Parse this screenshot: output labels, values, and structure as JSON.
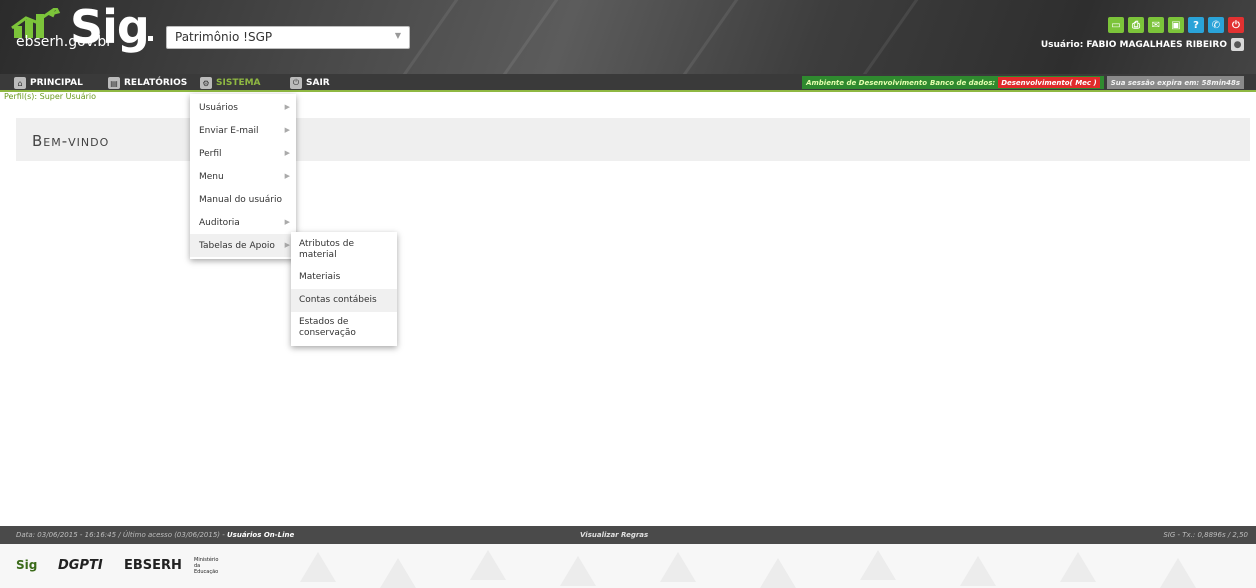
{
  "header": {
    "domain": "ebserh.gov.br",
    "logo_text": "Sig",
    "system_select": {
      "value": "Patrimônio !SGP"
    },
    "user_label": "Usuário: FABIO MAGALHAES RIBEIRO",
    "top_icons": [
      {
        "name": "monitor-icon",
        "color": "#7cc43a",
        "glyph": "▭"
      },
      {
        "name": "print-icon",
        "color": "#7cc43a",
        "glyph": "⎙"
      },
      {
        "name": "mail-icon",
        "color": "#7cc43a",
        "glyph": "✉"
      },
      {
        "name": "chat-icon",
        "color": "#7cc43a",
        "glyph": "▣"
      },
      {
        "name": "help-icon",
        "color": "#2aa3d8",
        "glyph": "?"
      },
      {
        "name": "phone-icon",
        "color": "#2aa3d8",
        "glyph": "✆"
      },
      {
        "name": "power-icon",
        "color": "#e23131",
        "glyph": "⏻"
      }
    ]
  },
  "nav": {
    "items": [
      {
        "label": "PRINCIPAL",
        "icon": "home-icon",
        "glyph": "⌂"
      },
      {
        "label": "RELATÓRIOS",
        "icon": "chart-icon",
        "glyph": "▤"
      },
      {
        "label": "SISTEMA",
        "icon": "gear-icon",
        "glyph": "⚙"
      },
      {
        "label": "SAIR",
        "icon": "power-icon",
        "glyph": "⏻"
      }
    ],
    "env_label": "Ambiente de Desenvolvimento",
    "db_label": "Banco de dados:",
    "db_value": "Desenvolvimento( Mec )",
    "session_label": "Sua sessão expira em: 58min48s"
  },
  "profile_text": "Perfil(s): Super Usuário",
  "welcome_title": "Bem-vindo",
  "system_menu": {
    "items": [
      {
        "label": "Usuários",
        "has_sub": true
      },
      {
        "label": "Enviar E-mail",
        "has_sub": true
      },
      {
        "label": "Perfil",
        "has_sub": true
      },
      {
        "label": "Menu",
        "has_sub": true
      },
      {
        "label": "Manual do usuário",
        "has_sub": false
      },
      {
        "label": "Auditoria",
        "has_sub": true
      },
      {
        "label": "Tabelas de Apoio",
        "has_sub": true
      }
    ],
    "submenu": [
      {
        "label": "Atributos de material"
      },
      {
        "label": "Materiais"
      },
      {
        "label": "Contas contábeis"
      },
      {
        "label": "Estados de conservação"
      }
    ]
  },
  "footer": {
    "left_text": "Data: 03/06/2015 - 16:16:45 / Último acesso (03/06/2015) -",
    "online_link": "Usuários On-Line",
    "center_link": "Visualizar Regras",
    "right_text": "SIG - Tx.: 0,8896s / 2,50",
    "logos": [
      "Sig",
      "DGPTI",
      "EBSERH",
      "Ministério da Educação"
    ]
  }
}
